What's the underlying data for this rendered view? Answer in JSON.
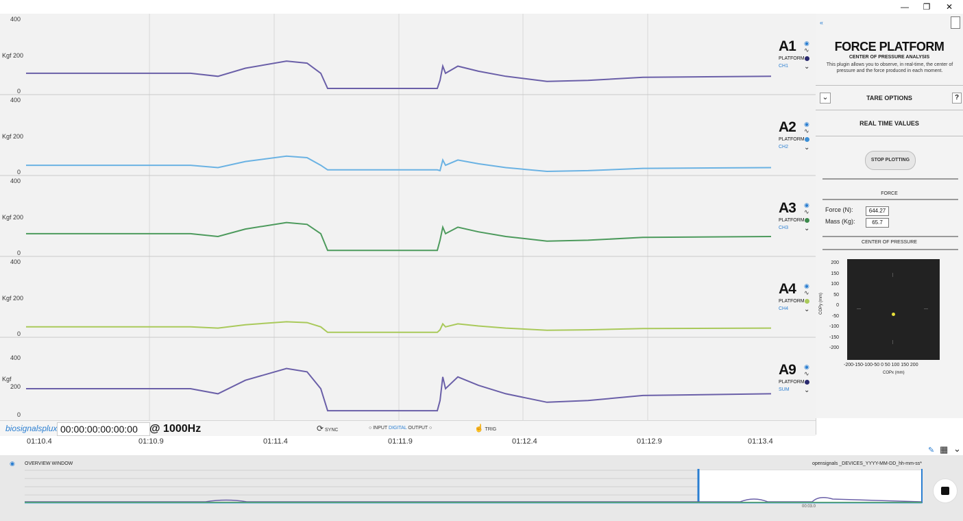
{
  "window": {
    "minimize_label": "—",
    "restore_label": "❐",
    "close_label": "✕"
  },
  "channels": [
    {
      "label": "A1",
      "platform": "PLATFORM",
      "sub": "CH1",
      "color": "#6a5fa8",
      "yunit": "Kgf 200",
      "ticks": [
        "400",
        "0"
      ]
    },
    {
      "label": "A2",
      "platform": "PLATFORM",
      "sub": "CH2",
      "color": "#6ab2e3",
      "yunit": "Kgf 200",
      "ticks": [
        "400",
        "0"
      ]
    },
    {
      "label": "A3",
      "platform": "PLATFORM",
      "sub": "CH3",
      "color": "#4c9a5c",
      "yunit": "Kgf 200",
      "ticks": [
        "400",
        "0"
      ]
    },
    {
      "label": "A4",
      "platform": "PLATFORM",
      "sub": "CH4",
      "color": "#a9c95a",
      "yunit": "Kgf 200",
      "ticks": [
        "400",
        "0"
      ]
    },
    {
      "label": "A9",
      "platform": "PLATFORM",
      "sub": "SUM",
      "color": "#6a5fa8",
      "yunit": "Kgf",
      "ticks": [
        "400",
        "200",
        "0"
      ]
    }
  ],
  "x_ticks": [
    "01:10.4",
    "01:10.9",
    "01:11.4",
    "01:11.9",
    "01:12.4",
    "01:12.9",
    "01:13.4"
  ],
  "bottom_bar": {
    "logo": "biosignalsplux",
    "timecode": "00:00:00:00:00:00",
    "rate": "@ 1000Hz",
    "sync": "SYNC",
    "input": "INPUT",
    "digital": "DIGITAL",
    "output": "OUTPUT",
    "trig": "TRIG"
  },
  "overview": {
    "title": "OVERVIEW WINDOW",
    "file": "opensignals _DEVICES_YYYY-MM-DD_hh-mm-ss*"
  },
  "panel": {
    "title": "FORCE PLATFORM",
    "subtitle": "CENTER OF PRESSURE ANALYSIS",
    "description": "This plugin allows you to observe, in real-time, the center of pressure and the force produced in each moment.",
    "tare": "TARE OPTIONS",
    "help": "?",
    "realtime": "REAL TIME VALUES",
    "stop": "STOP PLOTTING",
    "force_section": "FORCE",
    "force_label": "Force (N):",
    "force_value": "644.27",
    "mass_label": "Mass (Kg):",
    "mass_value": "65.7",
    "cop_section": "CENTER OF PRESSURE"
  },
  "cop_plot": {
    "ylabel": "COPy (mm)",
    "xlabel": "COPx (mm)",
    "yticks": [
      "200",
      "150",
      "100",
      "50",
      "0",
      "-50",
      "-100",
      "-150",
      "-200"
    ],
    "xticks": "-200-150-100-50 0 50 100 150 200",
    "point": {
      "x": 0,
      "y": -20
    },
    "point_color": "#e8e03a"
  },
  "icons": {
    "eye": "eye-icon",
    "wave": "wave-icon",
    "chevron": "chevron-down-icon",
    "collapse": "collapse-icon",
    "stop": "stop-icon"
  }
}
